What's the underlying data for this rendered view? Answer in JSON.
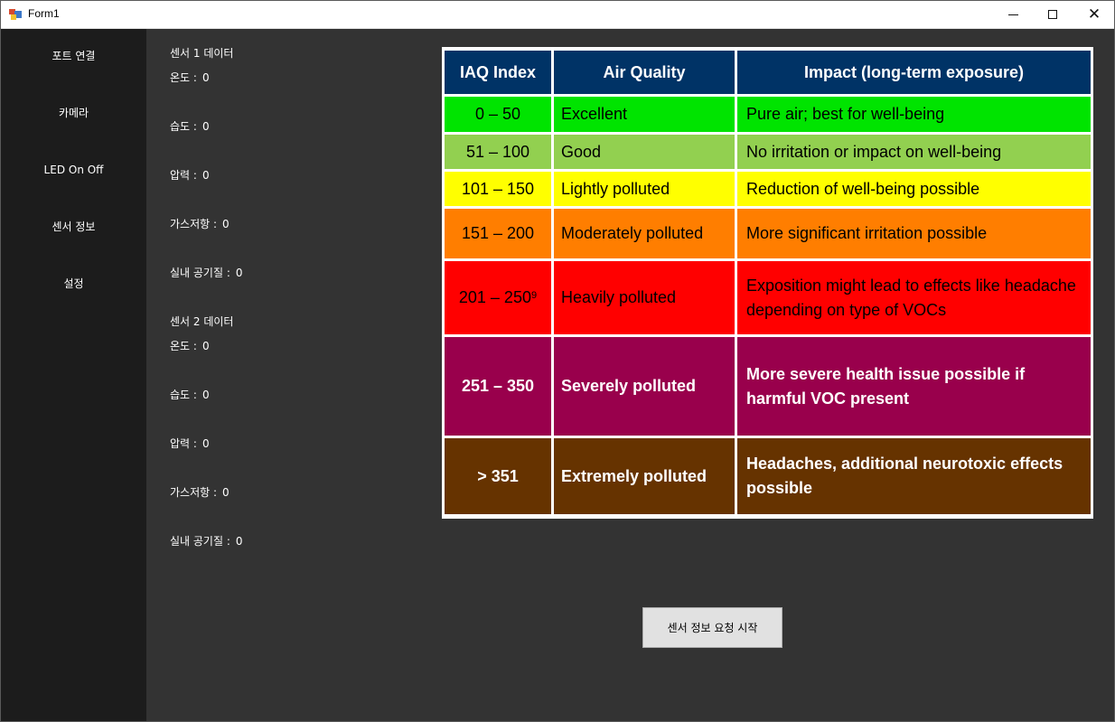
{
  "window": {
    "title": "Form1"
  },
  "sidebar": {
    "items": [
      {
        "label": "포트 연결"
      },
      {
        "label": "카메라"
      },
      {
        "label": "LED On Off"
      },
      {
        "label": "센서 정보"
      },
      {
        "label": "설정"
      }
    ]
  },
  "sensor1": {
    "title": "센서 1 데이터",
    "fields": [
      {
        "label": "온도 :",
        "value": "0"
      },
      {
        "label": "습도 :",
        "value": "0"
      },
      {
        "label": "압력 :",
        "value": "0"
      },
      {
        "label": "가스저항 :",
        "value": "0"
      },
      {
        "label": "실내 공기질 :",
        "value": "0"
      }
    ]
  },
  "sensor2": {
    "title": "센서 2 데이터",
    "fields": [
      {
        "label": "온도 :",
        "value": "0"
      },
      {
        "label": "습도 :",
        "value": "0"
      },
      {
        "label": "압력 :",
        "value": "0"
      },
      {
        "label": "가스저항 :",
        "value": "0"
      },
      {
        "label": "실내 공기질 :",
        "value": "0"
      }
    ]
  },
  "iaq_table": {
    "headers": [
      "IAQ Index",
      "Air Quality",
      "Impact (long-term exposure)"
    ],
    "rows": [
      {
        "index": "0 – 50",
        "quality": "Excellent",
        "impact": "Pure air; best for well-being",
        "color": "#00e400",
        "text_color": "#000000"
      },
      {
        "index": "51 – 100",
        "quality": "Good",
        "impact": "No irritation or impact on well-being",
        "color": "#92d050",
        "text_color": "#000000"
      },
      {
        "index": "101 – 150",
        "quality": "Lightly polluted",
        "impact": "Reduction of well-being possible",
        "color": "#ffff00",
        "text_color": "#000000"
      },
      {
        "index": "151 – 200",
        "quality": "Moderately polluted",
        "impact": "More significant irritation possible",
        "color": "#ff7e00",
        "text_color": "#000000"
      },
      {
        "index": "201 – 250",
        "index_sup": "9",
        "quality": "Heavily polluted",
        "impact": "Exposition might lead to effects like headache depending on type of VOCs",
        "color": "#ff0000",
        "text_color": "#000000"
      },
      {
        "index": "251 – 350",
        "quality": "Severely polluted",
        "impact": "More severe health issue possible if harmful VOC present",
        "color": "#99004c",
        "text_color": "#ffffff"
      },
      {
        "index": "> 351",
        "quality": "Extremely polluted",
        "impact": "Headaches, additional neurotoxic effects possible",
        "color": "#663300",
        "text_color": "#ffffff"
      }
    ],
    "header_color": "#003366"
  },
  "start_button": {
    "label": "센서 정보 요청 시작"
  }
}
